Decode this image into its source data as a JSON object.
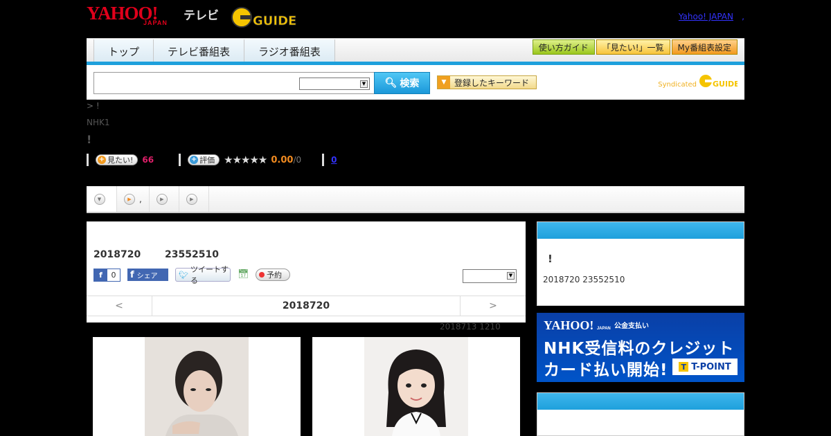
{
  "header": {
    "logo_yahoo": "YAHOO!",
    "logo_japan": "JAPAN",
    "logo_tv": "テレビ",
    "logo_gguide": "GUIDE",
    "yahoo_link": "Yahoo! JAPAN",
    "yahoo_link_sep": ","
  },
  "nav": {
    "tabs": [
      {
        "label": "トップ"
      },
      {
        "label": "テレビ番組表"
      },
      {
        "label": "ラジオ番組表"
      }
    ],
    "buttons": [
      {
        "label": "使い方ガイド"
      },
      {
        "label": "「見たい!」一覧"
      },
      {
        "label": "My番組表設定"
      }
    ]
  },
  "search": {
    "placeholder": "",
    "select_value": "",
    "button_label": "検索",
    "keyword_button": "登録したキーワード",
    "syndicated": "Syndicated",
    "syndicated_logo": "GUIDE"
  },
  "program": {
    "breadcrumb": "> !",
    "channel": "NHK1",
    "title": "!",
    "mitai_label": "見たい!",
    "mitai_count": "66",
    "rate_label": "評価",
    "stars": "★★★★★",
    "rating": "0.00",
    "rating_den": "/0",
    "review_count": "0"
  },
  "subtabs": [
    {
      "label": ""
    },
    {
      "label": ","
    },
    {
      "label": ""
    },
    {
      "label": ""
    }
  ],
  "main": {
    "air_date": "2018720",
    "air_time": "23552510",
    "fb_like_count": "0",
    "fb_share": "シェア",
    "tweet": "ツイートする",
    "reserve": "予約",
    "select_value": "",
    "datenav_prev": "<",
    "datenav_current": "2018720",
    "datenav_next": ">",
    "updated": "2018713  1210"
  },
  "side": {
    "box1_title": "!",
    "box1_date": "2018720  23552510"
  },
  "ad": {
    "yahoo": "YAHOO!",
    "japan": "JAPAN",
    "sub": "公金支払い",
    "line1": "NHK受信料のクレジット",
    "line2": "カード払い開始!",
    "tpoint": "T-POINT",
    "tpoint_mark": "T"
  },
  "colors": {
    "accent_blue": "#1ea0dc",
    "yahoo_red": "#e0001b",
    "mitai_pink": "#e0206a",
    "rating_orange": "#f08a20"
  }
}
